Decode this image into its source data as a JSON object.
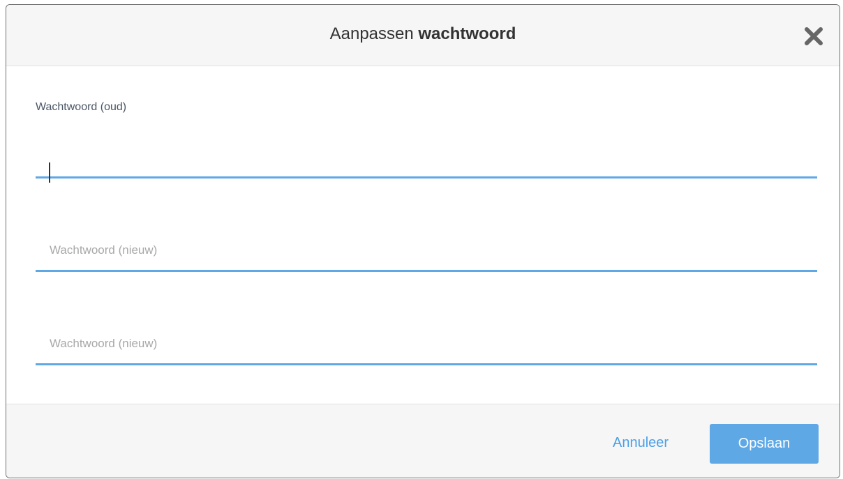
{
  "dialog": {
    "title_prefix": "Aanpassen",
    "title_bold": "wachtwoord",
    "close_icon": "close-icon"
  },
  "form": {
    "old_password": {
      "label": "Wachtwoord (oud)",
      "value": ""
    },
    "new_password": {
      "placeholder": "Wachtwoord (nieuw)",
      "value": ""
    },
    "confirm_password": {
      "placeholder": "Wachtwoord (nieuw)",
      "value": ""
    }
  },
  "footer": {
    "cancel_label": "Annuleer",
    "save_label": "Opslaan"
  },
  "colors": {
    "accent": "#5fa8e6",
    "link": "#4a9fe6",
    "header_bg": "#f6f6f6"
  }
}
